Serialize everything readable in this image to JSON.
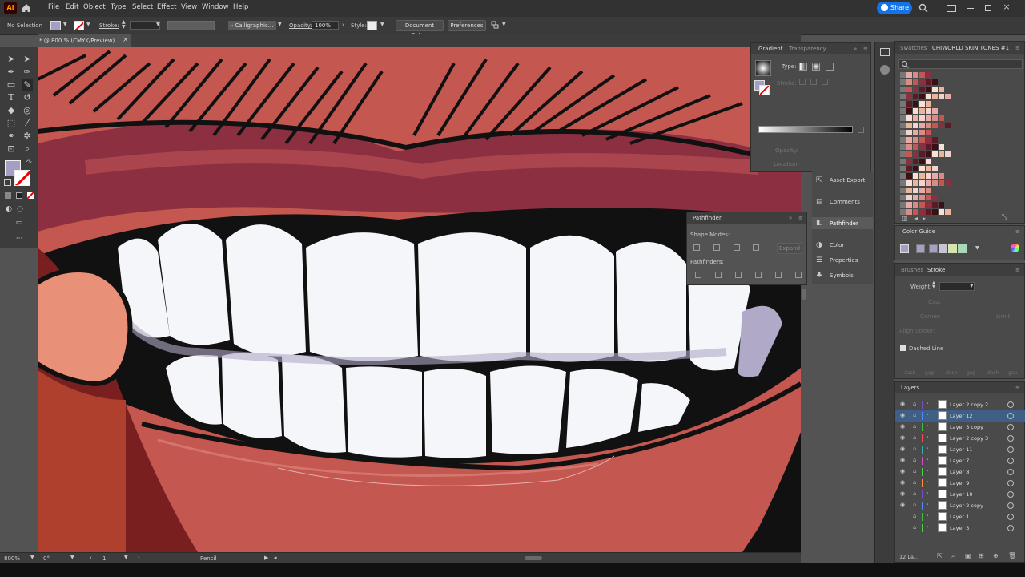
{
  "app": {
    "logo": "Ai"
  },
  "menu": [
    "File",
    "Edit",
    "Object",
    "Type",
    "Select",
    "Effect",
    "View",
    "Window",
    "Help"
  ],
  "share_label": "Share",
  "control": {
    "selection": "No Selection",
    "stroke_label": "Stroke:",
    "brush": "Calligraphic...",
    "opacity_label": "Opacity:",
    "opacity_value": "100%",
    "style_label": "Style:",
    "document_setup": "Document Setup",
    "preferences": "Preferences"
  },
  "document_tab": "* @ 800 % (CMYK/Preview)",
  "status": {
    "zoom": "800%",
    "rotation": "0°",
    "artboard": "1",
    "tool": "Pencil"
  },
  "gradient_panel": {
    "tabs": [
      "Gradient",
      "Transparency"
    ],
    "type_label": "Type:",
    "stroke_label": "Stroke:",
    "opacity_label": "Opacity:",
    "location_label": "Location:"
  },
  "dock_items": [
    "Asset Export",
    "Comments",
    "Pathfinder",
    "Color",
    "Properties",
    "Symbols"
  ],
  "pathfinder_panel": {
    "title": "Pathfinder",
    "shape_modes": "Shape Modes:",
    "pathfinders": "Pathfinders:",
    "expand": "Expand"
  },
  "swatches_panel": {
    "tabs": [
      "Swatches",
      "CHIWORLD SKIN TONES #1"
    ]
  },
  "color_guide": {
    "title": "Color Guide"
  },
  "stroke_panel": {
    "tabs": [
      "Brushes",
      "Stroke"
    ],
    "weight_label": "Weight:",
    "cap_label": "Cap:",
    "corner_label": "Corner:",
    "limit_label": "Limit:",
    "align_label": "Align Stroke:",
    "dashed_line": "Dashed Line",
    "dash_labels": [
      "dash",
      "gap",
      "dash",
      "gap",
      "dash",
      "gap"
    ]
  },
  "layers_panel": {
    "title": "Layers",
    "count": "12 La...",
    "layers": [
      {
        "name": "Layer 2 copy 2",
        "color": "#7a4ccc"
      },
      {
        "name": "Layer 12",
        "color": "#4c8cff",
        "selected": true
      },
      {
        "name": "Layer 3 copy",
        "color": "#3fbf3f"
      },
      {
        "name": "Layer 2 copy 3",
        "color": "#ff4c4c"
      },
      {
        "name": "Layer 11",
        "color": "#2fb0b0"
      },
      {
        "name": "Layer 7",
        "color": "#d04cd0"
      },
      {
        "name": "Layer 8",
        "color": "#4cd04c"
      },
      {
        "name": "Layer 9",
        "color": "#ff8c3c"
      },
      {
        "name": "Layer 10",
        "color": "#7a4ccc"
      },
      {
        "name": "Layer 2 copy",
        "color": "#4c8cff"
      },
      {
        "name": "Layer 1",
        "color": "#3fbf3f"
      },
      {
        "name": "Layer 3",
        "color": "#4cd04c"
      }
    ]
  },
  "colors": {
    "fill": "#a49fc4",
    "accent": "#1473e6",
    "skin": "#c4574f",
    "lip": "#8c3041",
    "teeth": "#f4f6fa"
  }
}
